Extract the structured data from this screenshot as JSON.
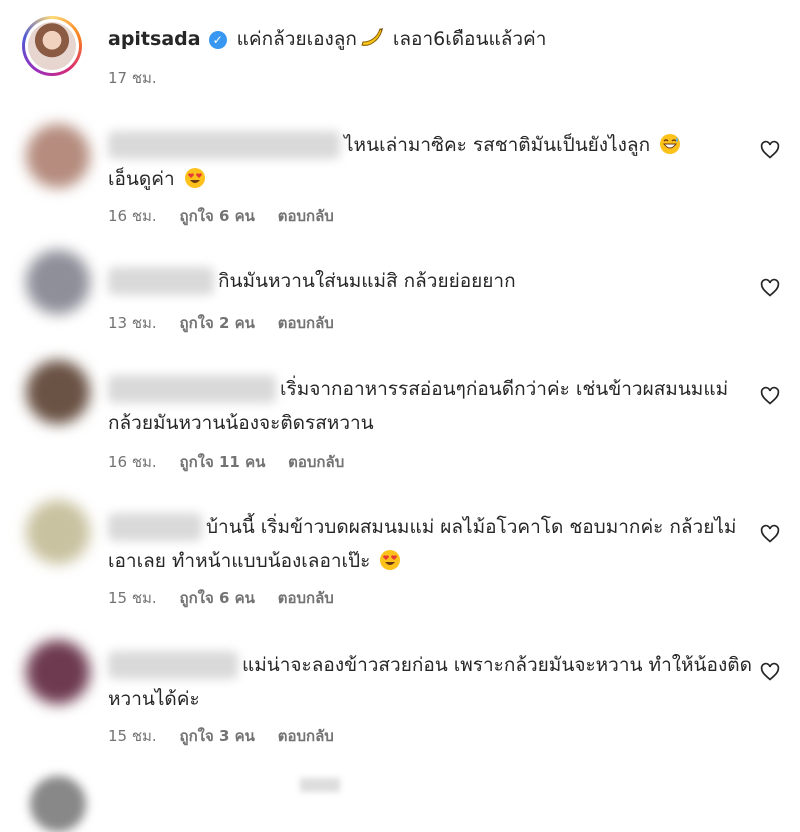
{
  "post": {
    "username": "apitsada",
    "caption_part1": "แค่กล้วยเองลูก",
    "caption_part2": "เลอา6เดือนแล้วค่า",
    "time": "17 ชม."
  },
  "comments": [
    {
      "text": "ไหนเล่ามาซิคะ รสชาติมันเป็นยังไงลูก",
      "text2": "เอ็นดูค่า",
      "time": "16 ชม.",
      "likes": "ถูกใจ 6 คน",
      "reply": "ตอบกลับ"
    },
    {
      "text": "กินมันหวานใส่นมแม่สิ กล้วยย่อยยาก",
      "time": "13 ชม.",
      "likes": "ถูกใจ 2 คน",
      "reply": "ตอบกลับ"
    },
    {
      "text": "เริ่มจากอาหารรสอ่อนๆก่อนดีกว่าค่ะ เช่นข้าวผสมนมแม่ กล้วยมันหวานน้องจะติดรสหวาน",
      "time": "16 ชม.",
      "likes": "ถูกใจ 11 คน",
      "reply": "ตอบกลับ"
    },
    {
      "text": "บ้านนี้ เริ่มข้าวบดผสมนมแม่ ผลไม้อโวคาโด ชอบมากค่ะ กล้วยไม่เอาเลย ทำหน้าแบบน้องเลอาเป๊ะ",
      "time": "15 ชม.",
      "likes": "ถูกใจ 6 คน",
      "reply": "ตอบกลับ"
    },
    {
      "text": "แม่น่าจะลองข้าวสวยก่อน เพราะกล้วยมันจะหวาน ทำให้น้องติดหวานได้ค่ะ",
      "time": "15 ชม.",
      "likes": "ถูกใจ 3 คน",
      "reply": "ตอบกลับ"
    }
  ],
  "icons": {
    "verified": "verified-badge-icon",
    "banana": "banana-emoji-icon",
    "laugh": "grinning-sweat-emoji-icon",
    "heart_eyes": "heart-eyes-emoji-icon",
    "like": "heart-outline-icon"
  },
  "colors": {
    "text": "#262626",
    "secondary": "#737373",
    "verified": "#3897f0"
  }
}
